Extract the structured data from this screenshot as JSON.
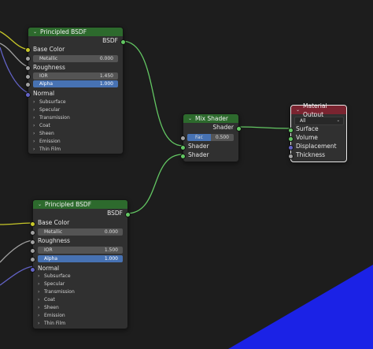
{
  "colors": {
    "background": "#1d1d1d",
    "node_body": "#303030",
    "shader_header": "#2d6a2d",
    "output_header": "#7a2430",
    "socket_color": "#c7c729",
    "socket_float": "#a1a1a1",
    "socket_vector": "#6363c7",
    "socket_shader": "#63c763",
    "field_active": "#4772b3",
    "viewport_plane": "#1b22e6"
  },
  "node1": {
    "title": "Principled BSDF",
    "output_label": "BSDF",
    "base_color_label": "Base Color",
    "metallic_label": "Metallic",
    "metallic_value": "0.000",
    "roughness_label": "Roughness",
    "ior_label": "IOR",
    "ior_value": "1.450",
    "alpha_label": "Alpha",
    "alpha_value": "1.000",
    "normal_label": "Normal",
    "panels": [
      "Subsurface",
      "Specular",
      "Transmission",
      "Coat",
      "Sheen",
      "Emission",
      "Thin Film"
    ]
  },
  "node2": {
    "title": "Principled BSDF",
    "output_label": "BSDF",
    "base_color_label": "Base Color",
    "metallic_label": "Metallic",
    "metallic_value": "0.000",
    "roughness_label": "Roughness",
    "ior_label": "IOR",
    "ior_value": "1.500",
    "alpha_label": "Alpha",
    "alpha_value": "1.000",
    "normal_label": "Normal",
    "panels": [
      "Subsurface",
      "Specular",
      "Transmission",
      "Coat",
      "Sheen",
      "Emission",
      "Thin Film"
    ]
  },
  "mix": {
    "title": "Mix Shader",
    "output_label": "Shader",
    "fac_label": "Fac",
    "fac_value": "0.500",
    "fac_fraction": 0.5,
    "input1_label": "Shader",
    "input2_label": "Shader"
  },
  "output": {
    "title": "Material Output",
    "target": "All",
    "surface_label": "Surface",
    "volume_label": "Volume",
    "displacement_label": "Displacement",
    "thickness_label": "Thickness"
  }
}
